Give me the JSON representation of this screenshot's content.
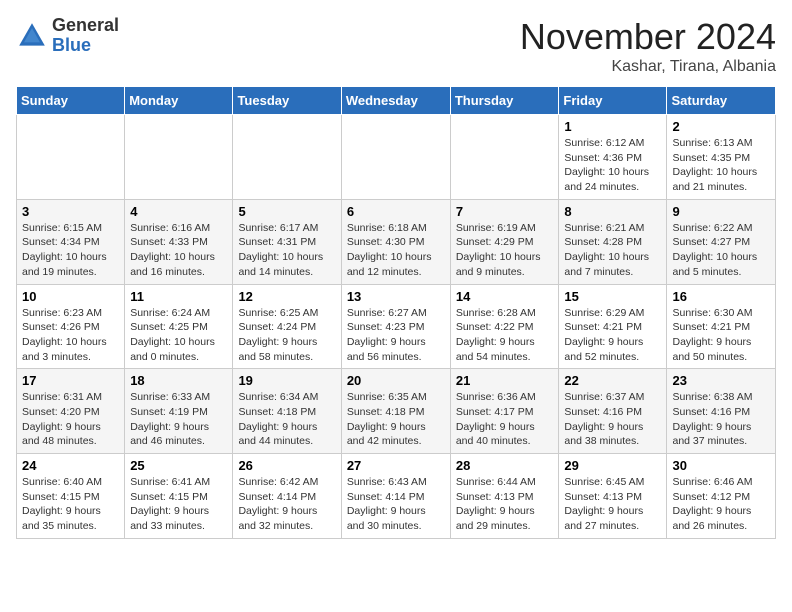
{
  "logo": {
    "general": "General",
    "blue": "Blue"
  },
  "header": {
    "month": "November 2024",
    "location": "Kashar, Tirana, Albania"
  },
  "weekdays": [
    "Sunday",
    "Monday",
    "Tuesday",
    "Wednesday",
    "Thursday",
    "Friday",
    "Saturday"
  ],
  "weeks": [
    [
      {
        "day": "",
        "info": ""
      },
      {
        "day": "",
        "info": ""
      },
      {
        "day": "",
        "info": ""
      },
      {
        "day": "",
        "info": ""
      },
      {
        "day": "",
        "info": ""
      },
      {
        "day": "1",
        "info": "Sunrise: 6:12 AM\nSunset: 4:36 PM\nDaylight: 10 hours and 24 minutes."
      },
      {
        "day": "2",
        "info": "Sunrise: 6:13 AM\nSunset: 4:35 PM\nDaylight: 10 hours and 21 minutes."
      }
    ],
    [
      {
        "day": "3",
        "info": "Sunrise: 6:15 AM\nSunset: 4:34 PM\nDaylight: 10 hours and 19 minutes."
      },
      {
        "day": "4",
        "info": "Sunrise: 6:16 AM\nSunset: 4:33 PM\nDaylight: 10 hours and 16 minutes."
      },
      {
        "day": "5",
        "info": "Sunrise: 6:17 AM\nSunset: 4:31 PM\nDaylight: 10 hours and 14 minutes."
      },
      {
        "day": "6",
        "info": "Sunrise: 6:18 AM\nSunset: 4:30 PM\nDaylight: 10 hours and 12 minutes."
      },
      {
        "day": "7",
        "info": "Sunrise: 6:19 AM\nSunset: 4:29 PM\nDaylight: 10 hours and 9 minutes."
      },
      {
        "day": "8",
        "info": "Sunrise: 6:21 AM\nSunset: 4:28 PM\nDaylight: 10 hours and 7 minutes."
      },
      {
        "day": "9",
        "info": "Sunrise: 6:22 AM\nSunset: 4:27 PM\nDaylight: 10 hours and 5 minutes."
      }
    ],
    [
      {
        "day": "10",
        "info": "Sunrise: 6:23 AM\nSunset: 4:26 PM\nDaylight: 10 hours and 3 minutes."
      },
      {
        "day": "11",
        "info": "Sunrise: 6:24 AM\nSunset: 4:25 PM\nDaylight: 10 hours and 0 minutes."
      },
      {
        "day": "12",
        "info": "Sunrise: 6:25 AM\nSunset: 4:24 PM\nDaylight: 9 hours and 58 minutes."
      },
      {
        "day": "13",
        "info": "Sunrise: 6:27 AM\nSunset: 4:23 PM\nDaylight: 9 hours and 56 minutes."
      },
      {
        "day": "14",
        "info": "Sunrise: 6:28 AM\nSunset: 4:22 PM\nDaylight: 9 hours and 54 minutes."
      },
      {
        "day": "15",
        "info": "Sunrise: 6:29 AM\nSunset: 4:21 PM\nDaylight: 9 hours and 52 minutes."
      },
      {
        "day": "16",
        "info": "Sunrise: 6:30 AM\nSunset: 4:21 PM\nDaylight: 9 hours and 50 minutes."
      }
    ],
    [
      {
        "day": "17",
        "info": "Sunrise: 6:31 AM\nSunset: 4:20 PM\nDaylight: 9 hours and 48 minutes."
      },
      {
        "day": "18",
        "info": "Sunrise: 6:33 AM\nSunset: 4:19 PM\nDaylight: 9 hours and 46 minutes."
      },
      {
        "day": "19",
        "info": "Sunrise: 6:34 AM\nSunset: 4:18 PM\nDaylight: 9 hours and 44 minutes."
      },
      {
        "day": "20",
        "info": "Sunrise: 6:35 AM\nSunset: 4:18 PM\nDaylight: 9 hours and 42 minutes."
      },
      {
        "day": "21",
        "info": "Sunrise: 6:36 AM\nSunset: 4:17 PM\nDaylight: 9 hours and 40 minutes."
      },
      {
        "day": "22",
        "info": "Sunrise: 6:37 AM\nSunset: 4:16 PM\nDaylight: 9 hours and 38 minutes."
      },
      {
        "day": "23",
        "info": "Sunrise: 6:38 AM\nSunset: 4:16 PM\nDaylight: 9 hours and 37 minutes."
      }
    ],
    [
      {
        "day": "24",
        "info": "Sunrise: 6:40 AM\nSunset: 4:15 PM\nDaylight: 9 hours and 35 minutes."
      },
      {
        "day": "25",
        "info": "Sunrise: 6:41 AM\nSunset: 4:15 PM\nDaylight: 9 hours and 33 minutes."
      },
      {
        "day": "26",
        "info": "Sunrise: 6:42 AM\nSunset: 4:14 PM\nDaylight: 9 hours and 32 minutes."
      },
      {
        "day": "27",
        "info": "Sunrise: 6:43 AM\nSunset: 4:14 PM\nDaylight: 9 hours and 30 minutes."
      },
      {
        "day": "28",
        "info": "Sunrise: 6:44 AM\nSunset: 4:13 PM\nDaylight: 9 hours and 29 minutes."
      },
      {
        "day": "29",
        "info": "Sunrise: 6:45 AM\nSunset: 4:13 PM\nDaylight: 9 hours and 27 minutes."
      },
      {
        "day": "30",
        "info": "Sunrise: 6:46 AM\nSunset: 4:12 PM\nDaylight: 9 hours and 26 minutes."
      }
    ]
  ]
}
